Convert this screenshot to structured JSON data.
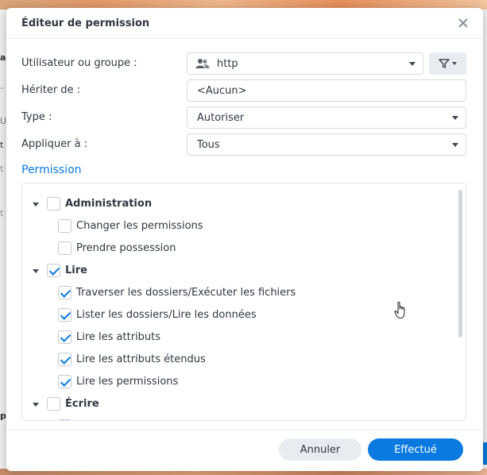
{
  "dialog": {
    "title": "Éditeur de permission",
    "close_icon": "close-icon"
  },
  "form": {
    "user_label": "Utilisateur ou groupe :",
    "user_value": "http",
    "user_icon": "users-icon",
    "filter_icon": "filter-icon",
    "inherit_label": "Hériter de :",
    "inherit_value": "<Aucun>",
    "type_label": "Type :",
    "type_value": "Autoriser",
    "apply_label": "Appliquer à :",
    "apply_value": "Tous"
  },
  "permission": {
    "section_title": "Permission",
    "tree": [
      {
        "label": "Administration",
        "group": true,
        "checked": false
      },
      {
        "label": "Changer les permissions",
        "group": false,
        "checked": false
      },
      {
        "label": "Prendre possession",
        "group": false,
        "checked": false
      },
      {
        "label": "Lire",
        "group": true,
        "checked": true
      },
      {
        "label": "Traverser les dossiers/Exécuter les fichiers",
        "group": false,
        "checked": true
      },
      {
        "label": "Lister les dossiers/Lire les données",
        "group": false,
        "checked": true
      },
      {
        "label": "Lire les attributs",
        "group": false,
        "checked": true
      },
      {
        "label": "Lire les attributs étendus",
        "group": false,
        "checked": true
      },
      {
        "label": "Lire les permissions",
        "group": false,
        "checked": true
      },
      {
        "label": "Écrire",
        "group": true,
        "checked": false
      }
    ]
  },
  "footer": {
    "cancel_label": "Annuler",
    "ok_label": "Effectué"
  },
  "background": {
    "chars": [
      "a",
      "-",
      "Ut",
      "t",
      "t",
      "t",
      "p"
    ]
  },
  "colors": {
    "accent": "#0a7ae0",
    "text": "#303841"
  }
}
